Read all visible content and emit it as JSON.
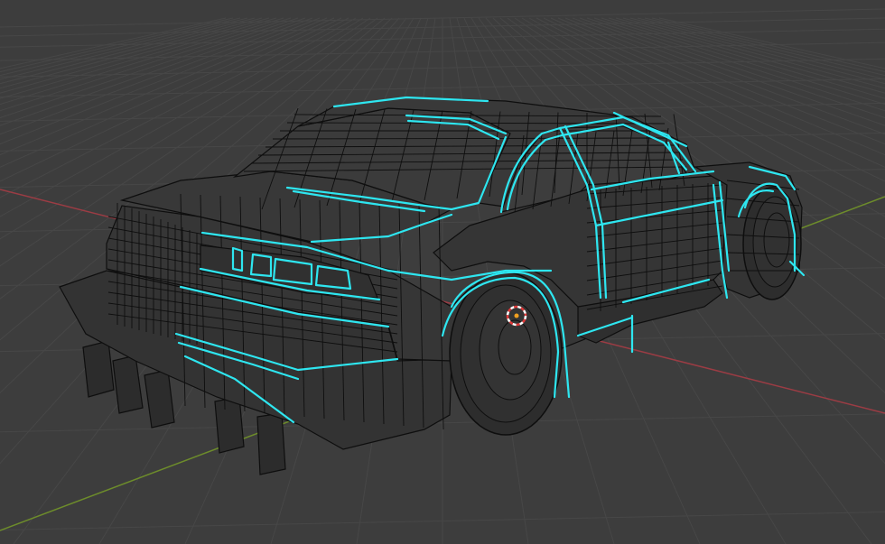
{
  "viewport": {
    "background": "#3d3d3d",
    "grid_color": "#474747",
    "x_axis_color": "#9b3c44",
    "y_axis_color": "#6d8c2b"
  },
  "model": {
    "body_color": "#333333",
    "panel_color": "#3a3a3a",
    "edge_color": "#0e0e0e",
    "selected_edge_color": "#2ee6f0"
  },
  "origin_marker": {
    "icon": "3d-cursor-icon",
    "ring_color_a": "#ffffff",
    "ring_color_b": "#e03a3a"
  }
}
